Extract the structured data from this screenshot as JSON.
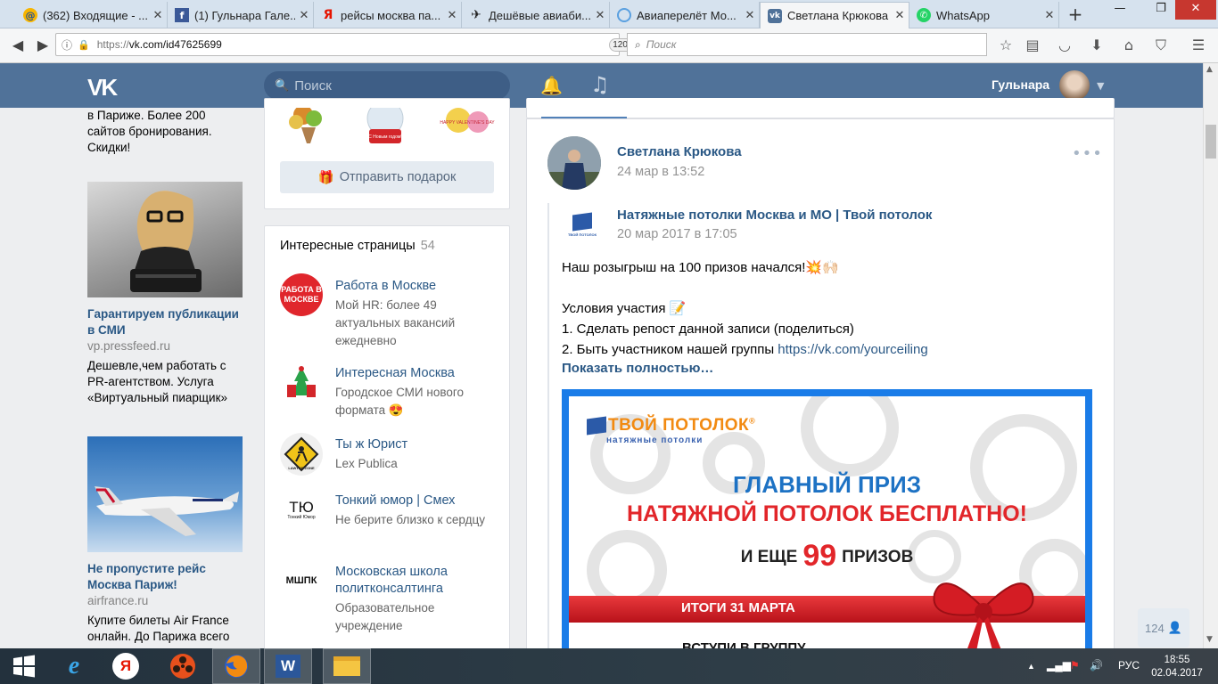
{
  "browser": {
    "tabs": [
      {
        "label": "(362) Входящие - ...",
        "icon": "mail-icon"
      },
      {
        "label": "(1) Гульнара Гале...",
        "icon": "facebook-icon"
      },
      {
        "label": "рейсы москва па...",
        "icon": "yandex-icon"
      },
      {
        "label": "Дешёвые авиаби...",
        "icon": "plane-icon"
      },
      {
        "label": "Авиаперелёт Мо...",
        "icon": "globe-icon"
      },
      {
        "label": "Светлана Крюкова",
        "icon": "vk-icon",
        "active": true
      },
      {
        "label": "WhatsApp",
        "icon": "whatsapp-icon"
      }
    ],
    "url_prefix": "https://",
    "url_host": "vk.com/id47625699",
    "zoom": "120%",
    "search_placeholder": "Поиск"
  },
  "vk": {
    "logo": "VK",
    "search_placeholder": "Поиск",
    "user_name": "Гульнара"
  },
  "ads": {
    "top_text": [
      "в Париже. Более 200",
      "сайтов бронирования.",
      "Скидки!"
    ],
    "items": [
      {
        "title": "Гарантируем публикации в СМИ",
        "domain": "vp.pressfeed.ru",
        "desc": "Дешевле,чем работать с PR-агентством. Услуга «Виртуальный пиарщик»"
      },
      {
        "title": "Не пропустите рейс Москва Париж!",
        "domain": "airfrance.ru",
        "desc": "Купите билеты Air France онлайн. До Парижа всего"
      }
    ]
  },
  "gifts": {
    "button_label": "Отправить подарок",
    "item2_text": "С Новым годом!",
    "item3_text": "HAPPY VALENTINE'S DAY"
  },
  "interesting_pages": {
    "title": "Интересные страницы",
    "count": "54",
    "items": [
      {
        "name": "Работа в Москве",
        "desc": "Мой HR: более 49 актуальных вакансий ежедневно",
        "icon_text": "РАБОТА В МОСКВЕ"
      },
      {
        "name": "Интересная Москва",
        "desc": "Городское СМИ нового формата 😍",
        "icon_text": ""
      },
      {
        "name": "Ты ж Юрист",
        "desc": "Lex Publica",
        "icon_text": "LAWYER ZONE"
      },
      {
        "name": "Тонкий юмор | Смех",
        "desc": "Не берите близко к сердцу",
        "icon_text": "ТЮ",
        "icon_sub": "Тонкий Юмор"
      },
      {
        "name": "Московская школа политконсалтинга",
        "desc": "Образовательное учреждение",
        "icon_text": "МШПК"
      }
    ]
  },
  "post": {
    "author": "Светлана Крюкова",
    "date": "24 мар в 13:52",
    "repost_group": "Натяжные потолки Москва и МО | Твой потолок",
    "repost_date": "20 мар 2017 в 17:05",
    "group_logo_text": "ТВОЙ ПОТОЛОК",
    "line1": "Наш розыгрыш на 100 призов начался!💥🙌🏻",
    "line2": "Условия участия 📝",
    "line3": "1. Сделать репост данной записи (поделиться)",
    "line4_prefix": "2. Быть участником нашей группы ",
    "line4_link": "https://vk.com/yourceiling",
    "show_more": "Показать полностью…",
    "banner": {
      "logo_title": "ТВОЙ ПОТОЛОК",
      "logo_reg": "®",
      "logo_sub": "натяжные потолки",
      "headline1": "ГЛАВНЫЙ ПРИЗ",
      "headline2": "НАТЯЖНОЙ ПОТОЛОК БЕСПЛАТНО!",
      "headline3_prefix": "И ЕЩЕ",
      "headline3_number": "99",
      "headline3_suffix": "ПРИЗОВ",
      "ribbon_text": "ИТОГИ 31 МАРТА",
      "footer_text": "ВСТУПИ В ГРУППУ"
    }
  },
  "online_count": "124",
  "taskbar": {
    "language": "РУС",
    "time": "18:55",
    "date": "02.04.2017"
  }
}
